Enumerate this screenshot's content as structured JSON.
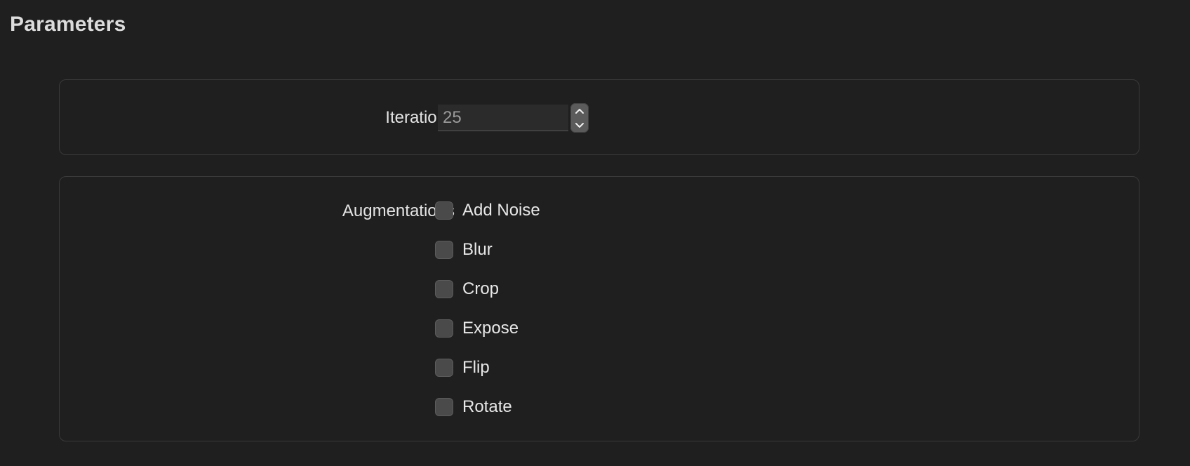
{
  "page": {
    "title": "Parameters"
  },
  "iterations": {
    "label": "Iterations",
    "value": "25",
    "stepper_up_icon": "chevron-up-icon",
    "stepper_down_icon": "chevron-down-icon"
  },
  "augmentations": {
    "label": "Augmentations",
    "options": [
      {
        "label": "Add Noise",
        "checked": false
      },
      {
        "label": "Blur",
        "checked": false
      },
      {
        "label": "Crop",
        "checked": false
      },
      {
        "label": "Expose",
        "checked": false
      },
      {
        "label": "Flip",
        "checked": false
      },
      {
        "label": "Rotate",
        "checked": false
      }
    ]
  },
  "colors": {
    "background": "#1f1f1f",
    "group_border": "#3a3a3a",
    "checkbox_fill": "#4a4a4a",
    "text": "#e6e6e6"
  }
}
